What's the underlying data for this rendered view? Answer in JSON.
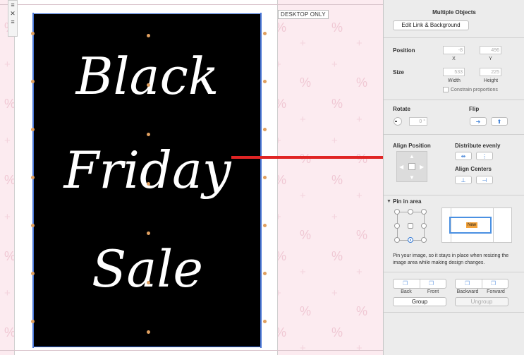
{
  "canvas": {
    "desktop_only_label": "DESKTOP ONLY",
    "banner_lines": [
      "Black",
      "Friday",
      "Sale"
    ],
    "rail_icons": [
      "hamburger-icon",
      "close-icon",
      "hamburger-icon"
    ],
    "arrow_color": "#e02424"
  },
  "panel": {
    "title": "Multiple Objects",
    "edit_link_button": "Edit Link & Background",
    "position": {
      "label": "Position",
      "x_value": "-8",
      "y_value": "496",
      "x_label": "X",
      "y_label": "Y"
    },
    "size": {
      "label": "Size",
      "width_value": "533",
      "height_value": "225",
      "width_label": "Width",
      "height_label": "Height",
      "constrain_label": "Constrain proportions"
    },
    "rotate": {
      "label": "Rotate",
      "value": "0 °"
    },
    "flip": {
      "label": "Flip"
    },
    "align_position": {
      "label": "Align Position"
    },
    "distribute": {
      "label": "Distribute evenly"
    },
    "align_centers": {
      "label": "Align Centers"
    },
    "pin": {
      "label": "Pin in area",
      "preview_badge": "New",
      "description": "Pin your image, so it stays in place when resizing the image area while making design changes."
    },
    "arrange": {
      "back": "Back",
      "front": "Front",
      "backward": "Backward",
      "forward": "Forward",
      "group": "Group",
      "ungroup": "Ungroup"
    }
  }
}
